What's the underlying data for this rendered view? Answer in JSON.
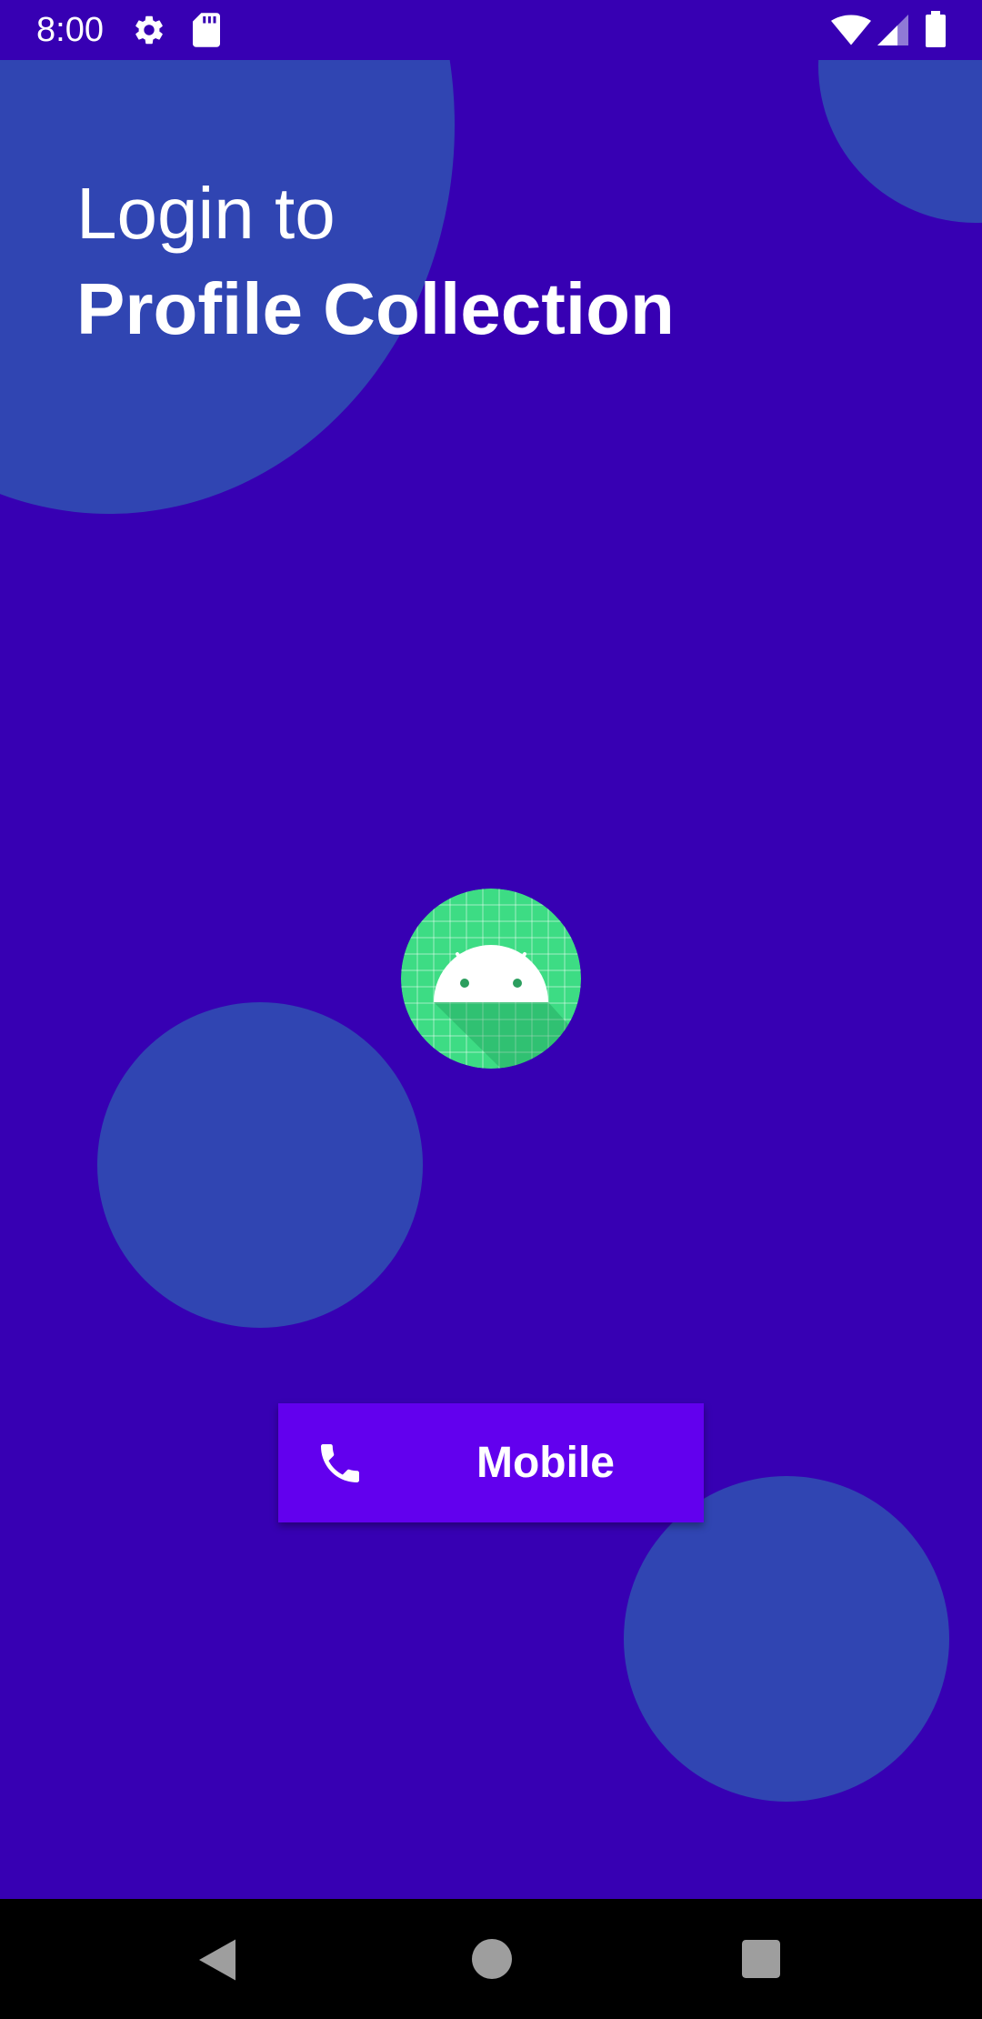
{
  "status_bar": {
    "time": "8:00",
    "icons": [
      "gear-icon",
      "sdcard-icon",
      "wifi-icon",
      "signal-icon",
      "battery-icon"
    ]
  },
  "heading": {
    "line1": "Login to",
    "line2": "Profile Collection"
  },
  "logo": {
    "icon": "android-icon"
  },
  "mobile_button": {
    "icon": "phone-icon",
    "label": "Mobile"
  },
  "nav_bar": {
    "buttons": [
      "back",
      "home",
      "recents"
    ]
  },
  "colors": {
    "background": "#3700b3",
    "circle": "#3045b2",
    "button": "#6200ee",
    "logo_green": "#3ddc84",
    "text": "#ffffff"
  }
}
